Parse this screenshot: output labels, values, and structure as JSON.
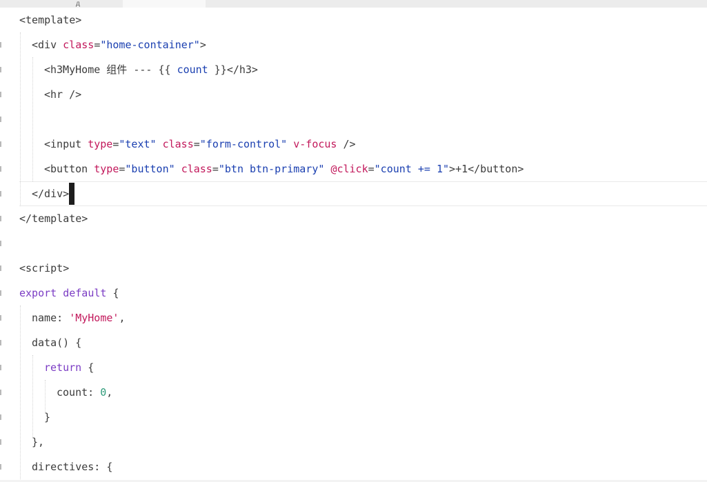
{
  "tabs": [
    {
      "label": "д",
      "active": false
    },
    {
      "label": "",
      "active": true
    }
  ],
  "colors": {
    "tag": "#3b3b3b",
    "attribute": "#c2185b",
    "string": "#1a3fb0",
    "keyword": "#7b3cc4",
    "number": "#2e9b7a",
    "plain": "#3b3b3b"
  },
  "code": [
    [
      {
        "t": "tag",
        "v": "<template>"
      }
    ],
    [
      {
        "t": "tag",
        "v": "<div "
      },
      {
        "t": "attribute",
        "v": "class"
      },
      {
        "t": "plain",
        "v": "="
      },
      {
        "t": "string",
        "v": "\"home-container\""
      },
      {
        "t": "tag",
        "v": ">"
      }
    ],
    [
      {
        "t": "tag",
        "v": "<h3"
      },
      {
        "t": "plain",
        "v": "MyHome 组件 --- {{ "
      },
      {
        "t": "string",
        "v": "count"
      },
      {
        "t": "plain",
        "v": " }}"
      },
      {
        "t": "tag",
        "v": "</h3>"
      }
    ],
    [
      {
        "t": "tag",
        "v": "<hr />"
      }
    ],
    [],
    [
      {
        "t": "tag",
        "v": "<input "
      },
      {
        "t": "attribute",
        "v": "type"
      },
      {
        "t": "plain",
        "v": "="
      },
      {
        "t": "string",
        "v": "\"text\""
      },
      {
        "t": "plain",
        "v": " "
      },
      {
        "t": "attribute",
        "v": "class"
      },
      {
        "t": "plain",
        "v": "="
      },
      {
        "t": "string",
        "v": "\"form-control\""
      },
      {
        "t": "plain",
        "v": " "
      },
      {
        "t": "attribute",
        "v": "v-focus"
      },
      {
        "t": "tag",
        "v": " />"
      }
    ],
    [
      {
        "t": "tag",
        "v": "<button "
      },
      {
        "t": "attribute",
        "v": "type"
      },
      {
        "t": "plain",
        "v": "="
      },
      {
        "t": "string",
        "v": "\"button\""
      },
      {
        "t": "plain",
        "v": " "
      },
      {
        "t": "attribute",
        "v": "class"
      },
      {
        "t": "plain",
        "v": "="
      },
      {
        "t": "string",
        "v": "\"btn btn-primary\""
      },
      {
        "t": "plain",
        "v": " "
      },
      {
        "t": "attribute",
        "v": "@click"
      },
      {
        "t": "plain",
        "v": "="
      },
      {
        "t": "string",
        "v": "\"count += 1\""
      },
      {
        "t": "tag",
        "v": ">"
      },
      {
        "t": "plain",
        "v": "+1"
      },
      {
        "t": "tag",
        "v": "</button>"
      }
    ],
    [
      {
        "t": "tag",
        "v": "</div>"
      }
    ],
    [
      {
        "t": "tag",
        "v": "</template>"
      }
    ],
    [],
    [
      {
        "t": "tag",
        "v": "<script>"
      }
    ],
    [
      {
        "t": "keyword",
        "v": "export default"
      },
      {
        "t": "plain",
        "v": " {"
      }
    ],
    [
      {
        "t": "plain",
        "v": "name: "
      },
      {
        "t": "attribute",
        "v": "'MyHome'"
      },
      {
        "t": "plain",
        "v": ","
      }
    ],
    [
      {
        "t": "plain",
        "v": "data() {"
      }
    ],
    [
      {
        "t": "keyword",
        "v": "return"
      },
      {
        "t": "plain",
        "v": " {"
      }
    ],
    [
      {
        "t": "plain",
        "v": "count: "
      },
      {
        "t": "number",
        "v": "0"
      },
      {
        "t": "plain",
        "v": ","
      }
    ],
    [
      {
        "t": "plain",
        "v": "}"
      }
    ],
    [
      {
        "t": "plain",
        "v": "},"
      }
    ],
    [
      {
        "t": "plain",
        "v": "directives: {"
      }
    ]
  ]
}
